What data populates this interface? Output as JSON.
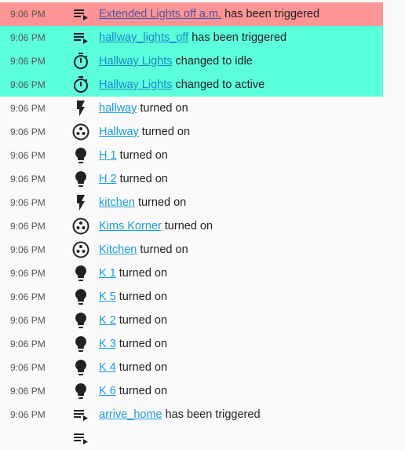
{
  "entries": [
    {
      "time": "9:06 PM",
      "icon": "automation-icon",
      "name": "Extended Lights off a.m.",
      "text": "has been triggered",
      "highlight": "red"
    },
    {
      "time": "9:06 PM",
      "icon": "automation-icon",
      "name": "hallway_lights_off",
      "text": "has been triggered",
      "highlight": "green"
    },
    {
      "time": "9:06 PM",
      "icon": "timer-icon",
      "name": "Hallway Lights",
      "text": "changed to idle",
      "highlight": "green"
    },
    {
      "time": "9:06 PM",
      "icon": "timer-icon",
      "name": "Hallway Lights",
      "text": "changed to active",
      "highlight": "green"
    },
    {
      "time": "9:06 PM",
      "icon": "flash-icon",
      "name": "hallway",
      "text": "turned on",
      "highlight": ""
    },
    {
      "time": "9:06 PM",
      "icon": "light-group-icon",
      "name": "Hallway",
      "text": "turned on",
      "highlight": ""
    },
    {
      "time": "9:06 PM",
      "icon": "bulb-icon",
      "name": "H 1",
      "text": "turned on",
      "highlight": ""
    },
    {
      "time": "9:06 PM",
      "icon": "bulb-icon",
      "name": "H 2",
      "text": "turned on",
      "highlight": ""
    },
    {
      "time": "9:06 PM",
      "icon": "flash-icon",
      "name": "kitchen",
      "text": "turned on",
      "highlight": ""
    },
    {
      "time": "9:06 PM",
      "icon": "light-group-icon",
      "name": "Kims Korner",
      "text": "turned on",
      "highlight": ""
    },
    {
      "time": "9:06 PM",
      "icon": "light-group-icon",
      "name": "Kitchen",
      "text": "turned on",
      "highlight": ""
    },
    {
      "time": "9:06 PM",
      "icon": "bulb-icon",
      "name": "K 1",
      "text": "turned on",
      "highlight": ""
    },
    {
      "time": "9:06 PM",
      "icon": "bulb-icon",
      "name": "K 5",
      "text": "turned on",
      "highlight": ""
    },
    {
      "time": "9:06 PM",
      "icon": "bulb-icon",
      "name": "K 2",
      "text": "turned on",
      "highlight": ""
    },
    {
      "time": "9:06 PM",
      "icon": "bulb-icon",
      "name": "K 3",
      "text": "turned on",
      "highlight": ""
    },
    {
      "time": "9:06 PM",
      "icon": "bulb-icon",
      "name": "K 4",
      "text": "turned on",
      "highlight": ""
    },
    {
      "time": "9:06 PM",
      "icon": "bulb-icon",
      "name": "K 6",
      "text": "turned on",
      "highlight": ""
    },
    {
      "time": "9:06 PM",
      "icon": "automation-icon",
      "name": "arrive_home",
      "text": "has been triggered",
      "highlight": ""
    },
    {
      "time": "",
      "icon": "automation-icon",
      "name": "",
      "text": "",
      "highlight": ""
    }
  ],
  "colors": {
    "highlight_red": "#ff9494",
    "highlight_green": "#5cffdc",
    "link": "#1e9ad6",
    "icon": "#212121"
  }
}
